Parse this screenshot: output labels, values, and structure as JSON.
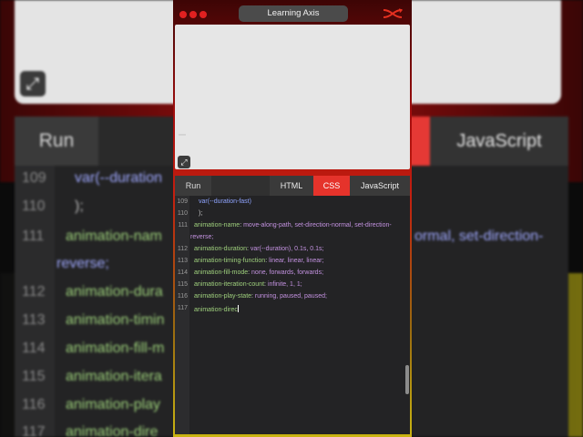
{
  "app": {
    "title": "Learning Axis"
  },
  "tabs": {
    "run": "Run",
    "html": "HTML",
    "css": "CSS",
    "javascript": "JavaScript"
  },
  "editor": {
    "lines": [
      {
        "n": "109",
        "code": "var(--duration-fast)"
      },
      {
        "n": "110",
        "code": ");"
      },
      {
        "n": "111",
        "prop": "animation-name",
        "value": "move-along-path, set-direction-normal, set-direction-",
        "cont": "reverse;"
      },
      {
        "n": "112",
        "prop": "animation-duration",
        "value": "var(--duration), 0.1s, 0.1s;"
      },
      {
        "n": "113",
        "prop": "animation-timing-function",
        "value": "linear, linear, linear;"
      },
      {
        "n": "114",
        "prop": "animation-fill-mode",
        "value": "none, forwards, forwards;"
      },
      {
        "n": "115",
        "prop": "animation-iteration-count",
        "value": "infinite, 1, 1;"
      },
      {
        "n": "116",
        "prop": "animation-play-state",
        "value": "running, paused, paused;"
      },
      {
        "n": "117",
        "code": "animation-direc"
      }
    ]
  },
  "background": {
    "run": "Run",
    "javascript": "JavaScript",
    "lines": [
      {
        "n": "109",
        "code": "var(--duration"
      },
      {
        "n": "110",
        "code": ");"
      },
      {
        "n": "111",
        "code": "animation-nam",
        "right": "ormal, set-direction-",
        "cont": "reverse;"
      },
      {
        "n": "112",
        "code": "animation-dura"
      },
      {
        "n": "113",
        "code": "animation-timin"
      },
      {
        "n": "114",
        "code": "animation-fill-m"
      },
      {
        "n": "115",
        "code": "animation-itera"
      },
      {
        "n": "116",
        "code": "animation-play"
      },
      {
        "n": "117",
        "code": "animation-dire"
      }
    ]
  },
  "colors": {
    "accent_red": "#e5332b",
    "property": "#9fd07d",
    "value": "#c392e0",
    "function": "#8fa4ff",
    "editor_bg": "#232325"
  },
  "icons": {
    "window_controls": "traffic-light-dots",
    "logo": "learning-axis-logo",
    "expand": "expand-arrows-icon"
  }
}
